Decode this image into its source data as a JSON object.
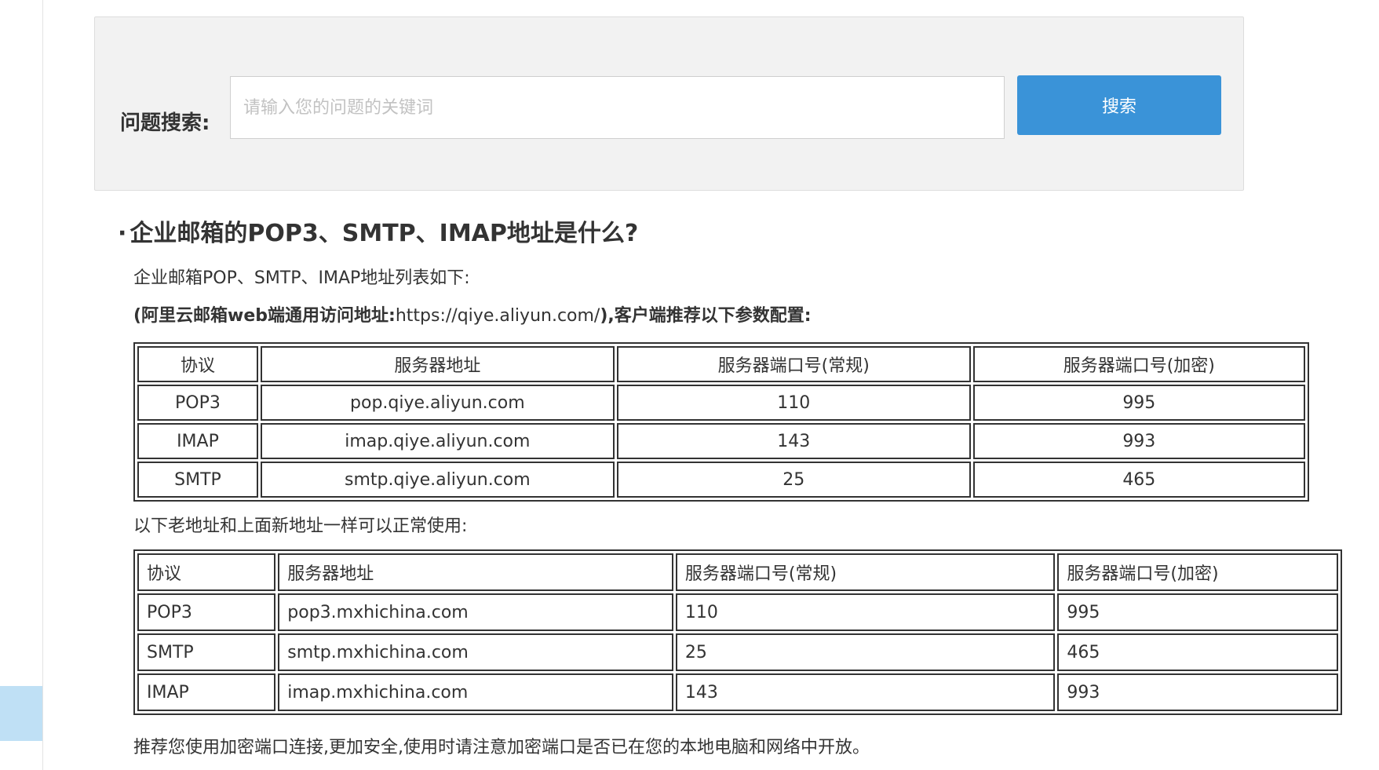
{
  "search": {
    "label": "问题搜索:",
    "placeholder": "请输入您的问题的关键词",
    "button_label": "搜索"
  },
  "article": {
    "bullet": "·",
    "title": "企业邮箱的POP3、SMTP、IMAP地址是什么?",
    "intro": "企业邮箱POP、SMTP、IMAP地址列表如下:",
    "note_prefix": "(阿里云邮箱web端通用访问地址:",
    "note_url": "https://qiye.aliyun.com/",
    "note_suffix": "),客户端推荐以下参数配置:",
    "old_intro": "以下老地址和上面新地址一样可以正常使用:",
    "footer": "推荐您使用加密端口连接,更加安全,使用时请注意加密端口是否已在您的本地电脑和网络中开放。"
  },
  "table_new": {
    "headers": [
      "协议",
      "服务器地址",
      "服务器端口号(常规)",
      "服务器端口号(加密)"
    ],
    "rows": [
      [
        "POP3",
        "pop.qiye.aliyun.com",
        "110",
        "995"
      ],
      [
        "IMAP",
        "imap.qiye.aliyun.com",
        "143",
        "993"
      ],
      [
        "SMTP",
        "smtp.qiye.aliyun.com",
        "25",
        "465"
      ]
    ]
  },
  "table_old": {
    "headers": [
      "协议",
      "服务器地址",
      "服务器端口号(常规)",
      "服务器端口号(加密)"
    ],
    "rows": [
      [
        "POP3",
        "pop3.mxhichina.com",
        "110",
        "995"
      ],
      [
        "SMTP",
        "smtp.mxhichina.com",
        "25",
        "465"
      ],
      [
        "IMAP",
        "imap.mxhichina.com",
        "143",
        "993"
      ]
    ]
  },
  "colors": {
    "button": "#3a93d8",
    "panel_bg": "#f2f2f2",
    "sidebar_tab": "#bfe0f5",
    "text": "#333333"
  }
}
